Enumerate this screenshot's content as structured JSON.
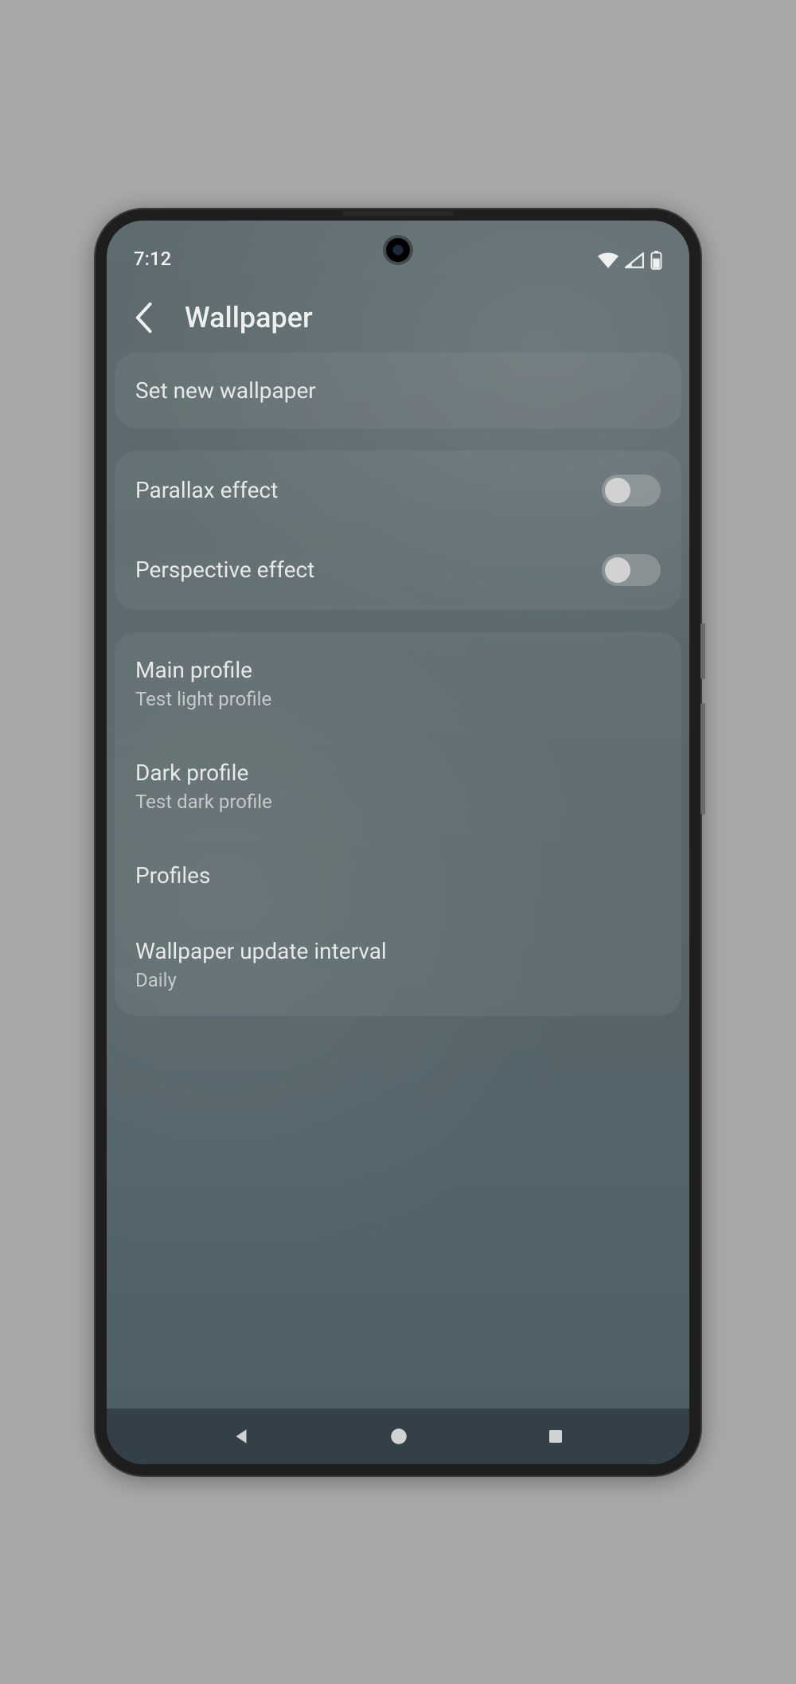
{
  "statusbar": {
    "time": "7:12"
  },
  "header": {
    "title": "Wallpaper"
  },
  "groups": [
    {
      "items": [
        {
          "title": "Set new wallpaper"
        }
      ]
    },
    {
      "items": [
        {
          "title": "Parallax effect",
          "toggle": false
        },
        {
          "title": "Perspective effect",
          "toggle": false
        }
      ]
    },
    {
      "items": [
        {
          "title": "Main profile",
          "subtitle": "Test light profile"
        },
        {
          "title": "Dark profile",
          "subtitle": "Test dark profile"
        },
        {
          "title": "Profiles"
        },
        {
          "title": "Wallpaper update interval",
          "subtitle": "Daily"
        }
      ]
    }
  ]
}
